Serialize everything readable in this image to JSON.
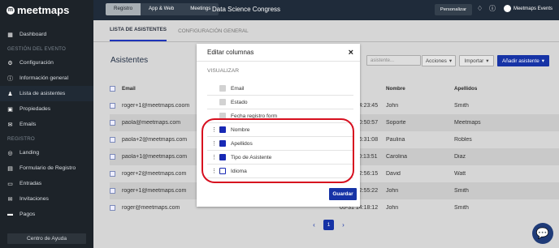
{
  "app": {
    "logo": "meetmaps"
  },
  "sidebar": {
    "items": [
      {
        "label": "Dashboard",
        "icon": "dashboard-icon"
      },
      {
        "label": "Configuración",
        "icon": "gear-icon"
      },
      {
        "label": "Información general",
        "icon": "info-icon"
      },
      {
        "label": "Lista de asistentes",
        "icon": "users-icon"
      },
      {
        "label": "Propiedades",
        "icon": "box-icon"
      },
      {
        "label": "Emails",
        "icon": "mail-icon"
      },
      {
        "label": "Landing",
        "icon": "globe-icon"
      },
      {
        "label": "Formulario de Registro",
        "icon": "form-icon"
      },
      {
        "label": "Entradas",
        "icon": "ticket-icon"
      },
      {
        "label": "Invitaciones",
        "icon": "mail-open-icon"
      },
      {
        "label": "Pagos",
        "icon": "card-icon"
      }
    ],
    "section_event": "GESTIÓN DEL EVENTO",
    "section_registration": "REGISTRO",
    "help": "Centro de Ayuda"
  },
  "topbar": {
    "tabs": [
      "Registro",
      "App & Web",
      "Meetings"
    ],
    "event": "Data Science Congress",
    "personalize": "Personalizar",
    "profile": "Meetmaps Events"
  },
  "subtabs": [
    "LISTA DE ASISTENTES",
    "CONFIGURACIÓN GENERAL"
  ],
  "main": {
    "heading": "Asistentes",
    "search_placeholder": "asistente...",
    "actions": "Acciones",
    "import": "Importar",
    "add": "Añadir asistente"
  },
  "table": {
    "headers": [
      "Email",
      "te alta",
      "Nombre",
      "Apellidos"
    ],
    "rows": [
      [
        "roger+1@meetmaps.coom",
        "18-07 14:23:45",
        "John",
        "Smith"
      ],
      [
        "paola@meetmaps.com",
        "07-10 10:50:57",
        "Soporte",
        "Meetmaps"
      ],
      [
        "paola+2@meetmaps.com",
        "04-17 16:31:08",
        "Paulina",
        "Robles"
      ],
      [
        "paola+1@meetmaps.com",
        "04-11 10:13:51",
        "Carolina",
        "Diaz"
      ],
      [
        "roger+2@meetmaps.com",
        "04-10 12:56:15",
        "David",
        "Watt"
      ],
      [
        "roger+1@meetmaps.com",
        "04-10 12:55:22",
        "John",
        "Smith"
      ],
      [
        "roger@meetmaps.com",
        "05-31 14:18:12",
        "John",
        "Smith"
      ]
    ]
  },
  "pagination": {
    "page": "1"
  },
  "modal": {
    "title": "Editar columnas",
    "section": "VISUALIZAR",
    "options": [
      {
        "label": "Email",
        "state": "disabled"
      },
      {
        "label": "Estado",
        "state": "disabled"
      },
      {
        "label": "Fecha registro form",
        "state": "disabled"
      },
      {
        "label": "Nombre",
        "state": "checked"
      },
      {
        "label": "Apellidos",
        "state": "checked"
      },
      {
        "label": "Tipo de Asistente",
        "state": "checked"
      },
      {
        "label": "Idioma",
        "state": "unchecked"
      }
    ],
    "save": "Guardar"
  }
}
